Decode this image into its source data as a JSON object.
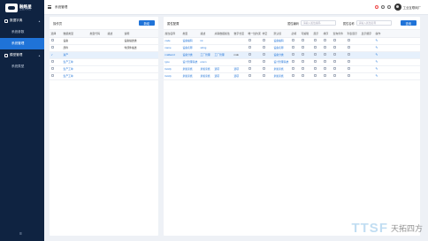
{
  "brand": {
    "name": "融略星",
    "sub": "工业大平台"
  },
  "sidebar": {
    "groups": [
      {
        "label": "数据字典",
        "items": [
          {
            "label": "系统参数"
          },
          {
            "label": "系统管理"
          }
        ]
      },
      {
        "label": "模型管理",
        "items": [
          {
            "label": "系统类型"
          }
        ]
      }
    ],
    "collapse_label": "≡"
  },
  "topbar": {
    "breadcrumb": "系统管理",
    "user": "工业互联网厂"
  },
  "left": {
    "title": "操作员",
    "add_label": "新增",
    "columns": [
      "选择",
      "数据类型",
      "类型代码",
      "描述",
      "说明"
    ],
    "rows": [
      {
        "type": "设备",
        "code": "",
        "desc": "",
        "note": "设备描述类",
        "check": ""
      },
      {
        "type": "部件",
        "code": "",
        "desc": "",
        "note": "零部件描述",
        "check": ""
      },
      {
        "type": "资产",
        "code": "",
        "desc": "",
        "note": "",
        "check": "✓",
        "selected": true
      },
      {
        "type": "生产工单",
        "code": "",
        "desc": "",
        "note": "",
        "check": ""
      },
      {
        "type": "生产工单",
        "code": "",
        "desc": "",
        "note": "",
        "check": ""
      },
      {
        "type": "生产工单",
        "code": "",
        "desc": "",
        "note": "",
        "check": ""
      }
    ]
  },
  "right": {
    "title": "属性配置",
    "filter1_label": "属性编码",
    "filter1_placeholder": "请输入属性编码",
    "filter2_label": "属性名称",
    "filter2_placeholder": "请输入属性名称",
    "search_label": "查询",
    "columns": [
      "属性名称",
      "类型",
      "描述",
      "关联数据属性",
      "数字长度",
      "唯一性约束",
      "非空",
      "默认值",
      "必填",
      "可编辑",
      "展示",
      "排序",
      "查询条件",
      "列表展示",
      "显示顺序",
      "操作"
    ],
    "rows": [
      {
        "name": "code",
        "type": "设备编码",
        "desc": "int",
        "rel": "",
        "len": "",
        "def": "设备编码"
      },
      {
        "name": "name",
        "type": "设备名称",
        "desc": "string",
        "rel": "",
        "len": "",
        "def": "设备名称"
      },
      {
        "name": "mallword",
        "type": "设备分类",
        "desc": "工厂管理",
        "rel": "工厂管理",
        "len": "mdo",
        "def": "设备分类",
        "selected": true
      },
      {
        "name": "type",
        "type": "设计管理系统",
        "desc": "enum",
        "rel": "",
        "len": "",
        "def": "设计管理系统"
      },
      {
        "name": "family",
        "type": "隶属家族",
        "desc": "隶属家族",
        "rel": "选项",
        "len": "选项",
        "def": "隶属家族"
      },
      {
        "name": "family",
        "type": "隶属家族",
        "desc": "隶属家族",
        "rel": "选项",
        "len": "选项",
        "def": "隶属家族"
      }
    ]
  },
  "watermark": {
    "logo": "TTSF",
    "text": "天拓四方"
  },
  "colors": {
    "sidebar": "#0f2341",
    "accent": "#1f73d8",
    "background": "#eef1f6"
  }
}
